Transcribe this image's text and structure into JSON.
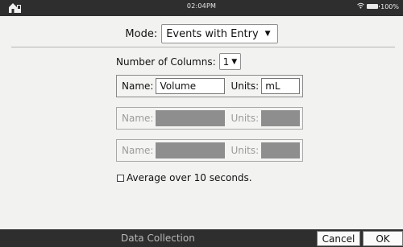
{
  "status_bar": {
    "time": "02:04PM",
    "battery": "100%",
    "icons": [
      "home-icon",
      "wifi-icon",
      "battery-icon"
    ]
  },
  "mode": {
    "label": "Mode:",
    "selected": "Events with Entry"
  },
  "columns": {
    "label": "Number of Columns:",
    "selected": "1"
  },
  "rows": [
    {
      "name_label": "Name:",
      "name_value": "Volume",
      "units_label": "Units:",
      "units_value": "mL",
      "enabled": true
    },
    {
      "name_label": "Name:",
      "name_value": "",
      "units_label": "Units:",
      "units_value": "",
      "enabled": false
    },
    {
      "name_label": "Name:",
      "name_value": "",
      "units_label": "Units:",
      "units_value": "",
      "enabled": false
    }
  ],
  "average": {
    "label": "Average over 10 seconds.",
    "checked": false
  },
  "bottom_bar": {
    "title": "Data Collection",
    "cancel_label": "Cancel",
    "ok_label": "OK"
  }
}
